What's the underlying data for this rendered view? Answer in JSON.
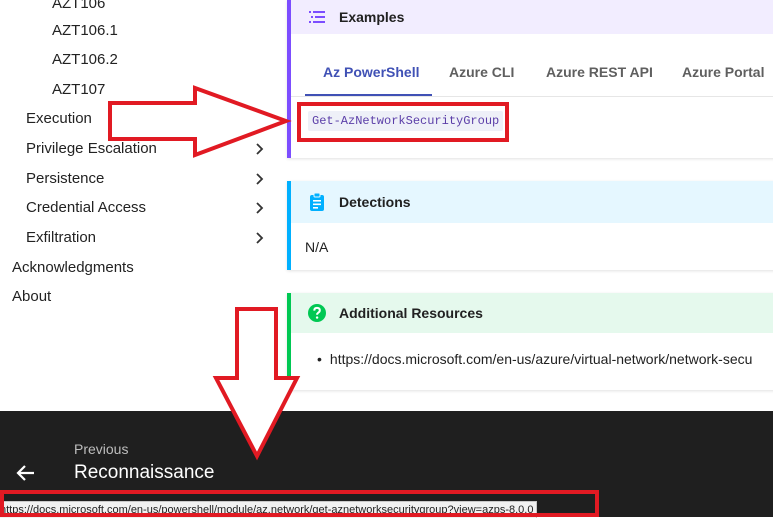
{
  "sidebar": {
    "sub_items": [
      {
        "label": "AZT106"
      },
      {
        "label": "AZT106.1"
      },
      {
        "label": "AZT106.2"
      },
      {
        "label": "AZT107"
      }
    ],
    "sections": [
      {
        "label": "Execution"
      },
      {
        "label": "Privilege Escalation"
      },
      {
        "label": "Persistence"
      },
      {
        "label": "Credential Access"
      },
      {
        "label": "Exfiltration"
      }
    ],
    "top_items": [
      {
        "label": "Acknowledgments"
      },
      {
        "label": "About"
      }
    ]
  },
  "examples": {
    "title": "Examples",
    "icon": "list-icon",
    "tabs": [
      {
        "label": "Az PowerShell",
        "active": true
      },
      {
        "label": "Azure CLI"
      },
      {
        "label": "Azure REST API"
      },
      {
        "label": "Azure Portal"
      }
    ],
    "code": "Get-AzNetworkSecurityGroup"
  },
  "detections": {
    "title": "Detections",
    "icon": "clipboard-icon",
    "body": "N/A"
  },
  "resources": {
    "title": "Additional Resources",
    "icon": "question-circle-icon",
    "items": [
      {
        "text": "https://docs.microsoft.com/en-us/azure/virtual-network/network-secu"
      }
    ]
  },
  "footer": {
    "previous_label": "Previous",
    "previous_title": "Reconnaissance"
  },
  "statusbar": {
    "url": "https://docs.microsoft.com/en-us/powershell/module/az.network/get-aznetworksecuritygroup?view=azps-8.0.0"
  },
  "colors": {
    "accent": "#4051b5",
    "examples_bar": "#7c4dff",
    "detections_bar": "#00b0ff",
    "resources_bar": "#00c853",
    "annotation_red": "#e11a23",
    "footer_bg": "#1f1f1f"
  }
}
